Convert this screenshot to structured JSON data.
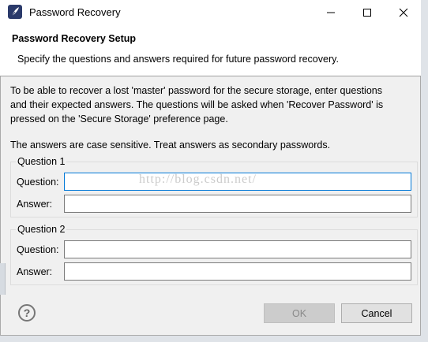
{
  "window": {
    "title": "Password Recovery",
    "icon": "feather-logo-icon"
  },
  "controls": {
    "minimize": "minimize-icon",
    "maximize": "maximize-icon",
    "close": "close-icon"
  },
  "header": {
    "title": "Password Recovery Setup",
    "description": "Specify the questions and answers required for future password recovery."
  },
  "body": {
    "paragraph_lines": [
      "To be able to recover a lost 'master' password for the secure storage, enter questions",
      "and their expected answers. The questions will be asked when 'Recover Password' is",
      "pressed on the 'Secure Storage' preference page."
    ],
    "note": "The answers are case sensitive. Treat answers as secondary passwords."
  },
  "groups": [
    {
      "title": "Question 1",
      "question_label": "Question:",
      "answer_label": "Answer:",
      "question_value": "",
      "answer_value": ""
    },
    {
      "title": "Question 2",
      "question_label": "Question:",
      "answer_label": "Answer:",
      "question_value": "",
      "answer_value": ""
    }
  ],
  "watermark": "http://blog.csdn.net/",
  "footer": {
    "help_label": "?",
    "ok_label": "OK",
    "cancel_label": "Cancel"
  },
  "colors": {
    "focus_border": "#0078d7",
    "disabled_button": "#cccccc"
  }
}
